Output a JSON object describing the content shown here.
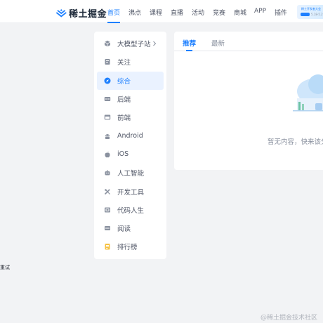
{
  "header": {
    "logo_text": "稀土掘金",
    "nav": [
      {
        "label": "首页",
        "active": true
      },
      {
        "label": "沸点"
      },
      {
        "label": "课程"
      },
      {
        "label": "直播"
      },
      {
        "label": "活动"
      },
      {
        "label": "竞赛"
      },
      {
        "label": "商城"
      },
      {
        "label": "APP"
      },
      {
        "label": "插件"
      }
    ],
    "banner": {
      "line1": "稀土开发者大会",
      "badge": "",
      "line2": "5.18-5.2"
    }
  },
  "sidebar": {
    "items": [
      {
        "label": "大模型子站",
        "icon": "cube-icon"
      },
      {
        "label": "关注",
        "icon": "bookmark-icon"
      },
      {
        "label": "综合",
        "icon": "compass-icon",
        "active": true
      },
      {
        "label": "后端",
        "icon": "server-icon"
      },
      {
        "label": "前端",
        "icon": "browser-icon"
      },
      {
        "label": "Android",
        "icon": "android-icon"
      },
      {
        "label": "iOS",
        "icon": "apple-icon"
      },
      {
        "label": "人工智能",
        "icon": "robot-icon"
      },
      {
        "label": "开发工具",
        "icon": "tools-icon"
      },
      {
        "label": "代码人生",
        "icon": "code-file-icon"
      },
      {
        "label": "阅读",
        "icon": "book-icon"
      },
      {
        "label": "排行榜",
        "icon": "trophy-icon"
      }
    ]
  },
  "main": {
    "tabs": [
      {
        "label": "推荐",
        "active": true
      },
      {
        "label": "最新"
      }
    ],
    "empty_text": "暂无内容，快来该分"
  },
  "side_note": "重试",
  "watermark": "@稀土掘金技术社区",
  "colors": {
    "accent": "#1e80ff",
    "background": "#f2f3f5",
    "active_bg": "#eaf2ff"
  }
}
